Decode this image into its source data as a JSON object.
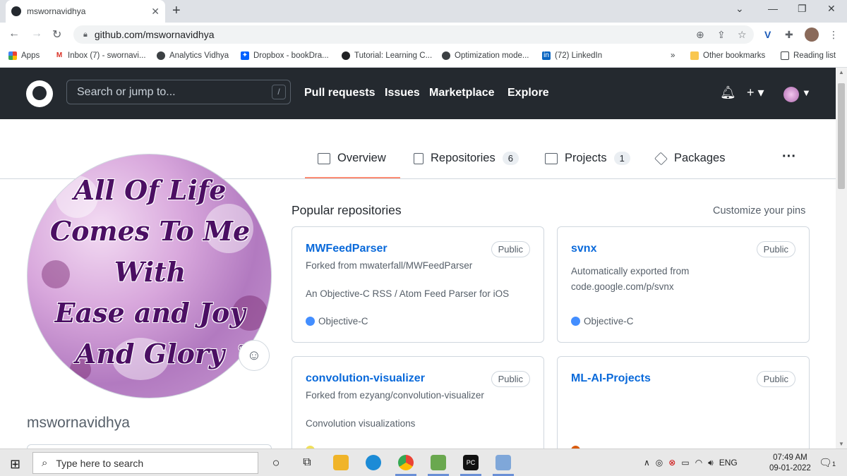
{
  "browser": {
    "tab_title": "mswornavidhya",
    "url": "github.com/mswornavidhya",
    "bookmarks": [
      {
        "label": "Apps",
        "color": "#ea4335"
      },
      {
        "label": "Inbox (7) - swornavi...",
        "color": "#d93025"
      },
      {
        "label": "Analytics Vidhya",
        "color": "#3c4043"
      },
      {
        "label": "Dropbox - bookDra...",
        "color": "#0061ff"
      },
      {
        "label": "Tutorial: Learning C...",
        "color": "#202124"
      },
      {
        "label": "Optimization mode...",
        "color": "#3c4043"
      },
      {
        "label": "(72) LinkedIn",
        "color": "#0a66c2"
      }
    ],
    "bookmarks_overflow": "»",
    "other_bookmarks": "Other bookmarks",
    "reading_list": "Reading list"
  },
  "github": {
    "search_placeholder": "Search or jump to...",
    "search_shortcut": "/",
    "nav": [
      "Pull requests",
      "Issues",
      "Marketplace",
      "Explore"
    ]
  },
  "profile_tabs": [
    {
      "label": "Overview",
      "count": null
    },
    {
      "label": "Repositories",
      "count": "6"
    },
    {
      "label": "Projects",
      "count": "1"
    },
    {
      "label": "Packages",
      "count": null
    }
  ],
  "avatar_quote": [
    "All Of Life",
    "Comes To Me",
    "With",
    "Ease and Joy",
    "And Glory"
  ],
  "avatar_trademark": "®",
  "username": "mswornavidhya",
  "popular": {
    "title": "Popular repositories",
    "customize": "Customize your pins",
    "repos": [
      {
        "name": "MWFeedParser",
        "visibility": "Public",
        "fork": "Forked from mwaterfall/MWFeedParser",
        "description": "An Objective-C RSS / Atom Feed Parser for iOS",
        "language": "Objective-C",
        "lang_color": "#438eff"
      },
      {
        "name": "svnx",
        "visibility": "Public",
        "fork": "",
        "description": "Automatically exported from code.google.com/p/svnx",
        "language": "Objective-C",
        "lang_color": "#438eff"
      },
      {
        "name": "convolution-visualizer",
        "visibility": "Public",
        "fork": "Forked from ezyang/convolution-visualizer",
        "description": "Convolution visualizations",
        "language": "",
        "lang_color": "#f1e05a"
      },
      {
        "name": "ML-AI-Projects",
        "visibility": "Public",
        "fork": "",
        "description": "",
        "language": "",
        "lang_color": "#da5b0b"
      }
    ]
  },
  "taskbar": {
    "search_placeholder": "Type here to search",
    "lang": "ENG",
    "time": "07:49 AM",
    "date": "09-01-2022",
    "notif_count": "1"
  }
}
